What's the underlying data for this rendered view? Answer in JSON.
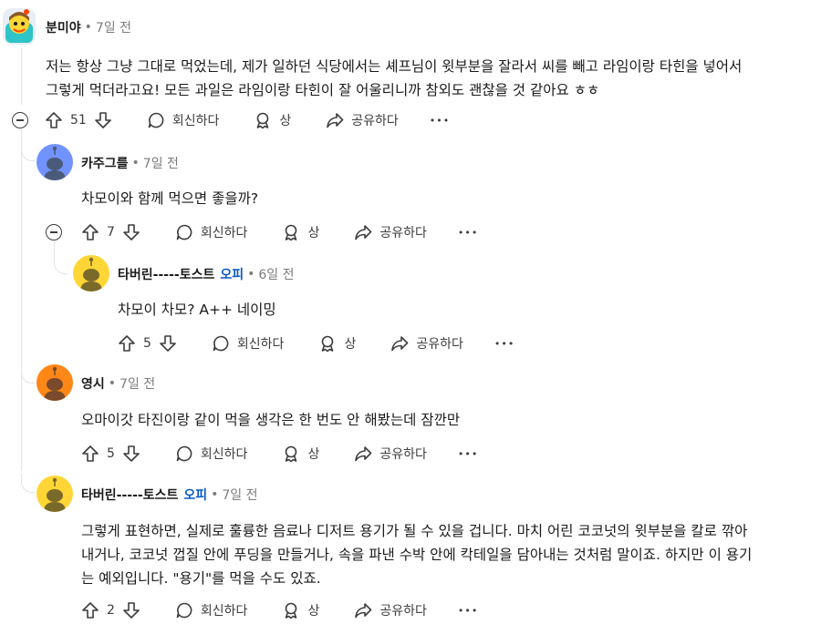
{
  "comments": [
    {
      "username": "분미야",
      "time": "7일 전",
      "body": [
        "저는 항상 그냥 그대로 먹었는데, 제가 일하던 식당에서는 셰프님이 윗부분을 잘라서 씨를 빼고 라임이랑 타힌을 넣어서",
        "그렇게 먹더라고요! 모든 과일은 라임이랑 타힌이 잘 어울리니까 참외도 괜찮을 것 같아요 ㅎㅎ"
      ],
      "votes": "51"
    },
    {
      "username": "카주그를",
      "time": "7일 전",
      "body": [
        "차모이와 함께 먹으면 좋을까?"
      ],
      "votes": "7"
    },
    {
      "username": "타버린-----토스트",
      "op": "오피",
      "time": "6일 전",
      "body": [
        "차모이 차모? A++ 네이밍"
      ],
      "votes": "5"
    },
    {
      "username": "영시",
      "time": "7일 전",
      "body": [
        "오마이갓 타진이랑 같이 먹을 생각은 한 번도 안 해봤는데 잠깐만"
      ],
      "votes": "5"
    },
    {
      "username": "타버린-----토스트",
      "op": "오피",
      "time": "7일 전",
      "body": [
        "그렇게 표현하면, 실제로 훌륭한 음료나 디저트 용기가 될 수 있을 겁니다. 마치 어린 코코넛의 윗부분을 칼로 깎아",
        "내거나, 코코넛 껍질 안에 푸딩을 만들거나, 속을 파낸 수박 안에 칵테일을 담아내는 것처럼 말이죠. 하지만 이 용기",
        "는 예외입니다. \"용기\"를 먹을 수도 있죠."
      ],
      "votes": "2"
    }
  ],
  "actions": {
    "reply": "회신하다",
    "award": "상",
    "share": "공유하다",
    "more": "•••"
  },
  "separator": "•",
  "icons": [
    "upvote-icon",
    "downvote-icon",
    "comment-icon",
    "award-icon",
    "share-icon",
    "more-icon",
    "collapse-icon"
  ],
  "colors": {
    "op": "#0a5ac2",
    "avatar_blue": "#7193ff",
    "avatar_yellow": "#ffd635",
    "avatar_orange": "#ff8717"
  }
}
